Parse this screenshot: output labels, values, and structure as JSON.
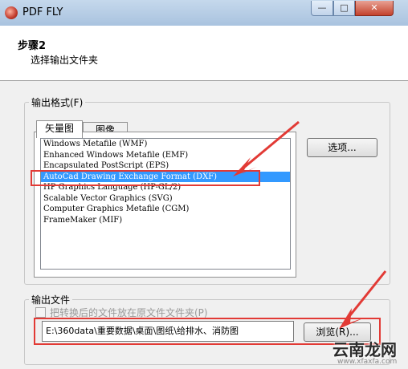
{
  "window": {
    "title": "PDF FLY",
    "minimize": "—",
    "maximize": "□",
    "close": "✕"
  },
  "header": {
    "step": "步骤2",
    "subtitle": "选择输出文件夹"
  },
  "format_group": {
    "label": "输出格式(F)",
    "tabs": [
      "矢量图",
      "图像"
    ],
    "list_items": [
      "Windows Metafile (WMF)",
      "Enhanced Windows Metafile (EMF)",
      "Encapsulated PostScript (EPS)",
      "AutoCad Drawing Exchange Format (DXF)",
      "HP Graphics Language (HP-GL/2)",
      "Scalable Vector Graphics (SVG)",
      "Computer Graphics Metafile (CGM)",
      "FrameMaker (MIF)"
    ],
    "selected_index": 3,
    "options_button": "选项..."
  },
  "output_group": {
    "label": "输出文件",
    "checkbox_label": "把转换后的文件放在原文件文件夹(P)",
    "path_value": "E:\\360data\\重要数据\\桌面\\图纸\\给排水、消防图",
    "browse_button": "浏览(R)..."
  },
  "watermark": {
    "text": "云南龙网",
    "url": "www.xfaxfa.com"
  },
  "colors": {
    "selection": "#3399ff",
    "annotation": "#e23a35"
  }
}
